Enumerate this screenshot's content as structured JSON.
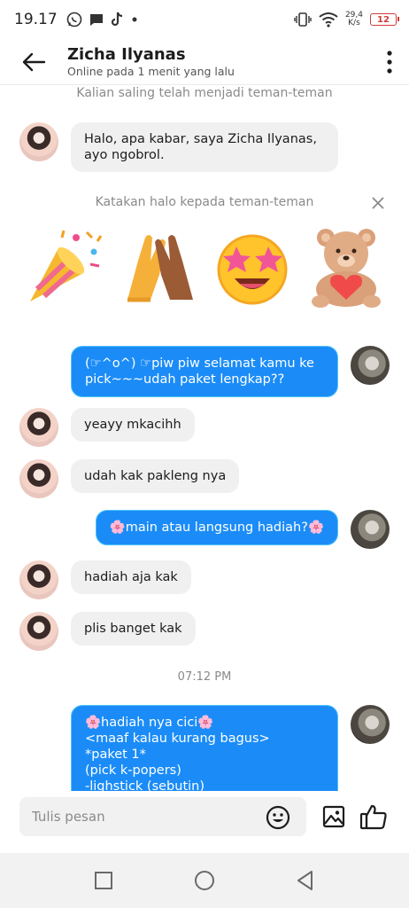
{
  "status_bar": {
    "time": "19.17",
    "net_speed_value": "29,4",
    "net_speed_unit": "K/s",
    "battery": "12"
  },
  "header": {
    "name": "Zicha Ilyanas",
    "status": "Online pada 1 menit yang lalu"
  },
  "chat": {
    "friends_notice": "Kalian saling telah  menjadi teman-teman",
    "suggest_hello": "Katakan halo kepada  teman-teman",
    "timestamp": "07:12 PM",
    "stickers": [
      "party-popper-sticker",
      "high-five-sticker",
      "star-eyes-sticker",
      "teddy-bear-heart-sticker"
    ],
    "messages": [
      {
        "from": "them",
        "text": "Halo, apa kabar,  saya Zicha Ilyanas, ayo ngobrol."
      },
      {
        "from": "me",
        "text": "(☞^o^) ☞piw piw selamat kamu ke pick~~~udah paket lengkap??"
      },
      {
        "from": "them",
        "text": "yeayy mkacihh"
      },
      {
        "from": "them",
        "text": "udah kak pakleng nya"
      },
      {
        "from": "me",
        "text": "🌸main atau langsung hadiah?🌸"
      },
      {
        "from": "them",
        "text": "hadiah aja kak"
      },
      {
        "from": "them",
        "text": "plis banget kak"
      },
      {
        "from": "me",
        "text": "🌸hadiah nya cici🌸\n<maaf kalau kurang bagus>\n*paket 1*\n(pick k-popers)\n-lighstick (sebutin)"
      }
    ]
  },
  "input": {
    "placeholder": "Tulis pesan"
  },
  "colors": {
    "sent_bubble": "#1b8cf7",
    "received_bubble": "#f0f0f0",
    "battery_low": "#d23a3a"
  }
}
